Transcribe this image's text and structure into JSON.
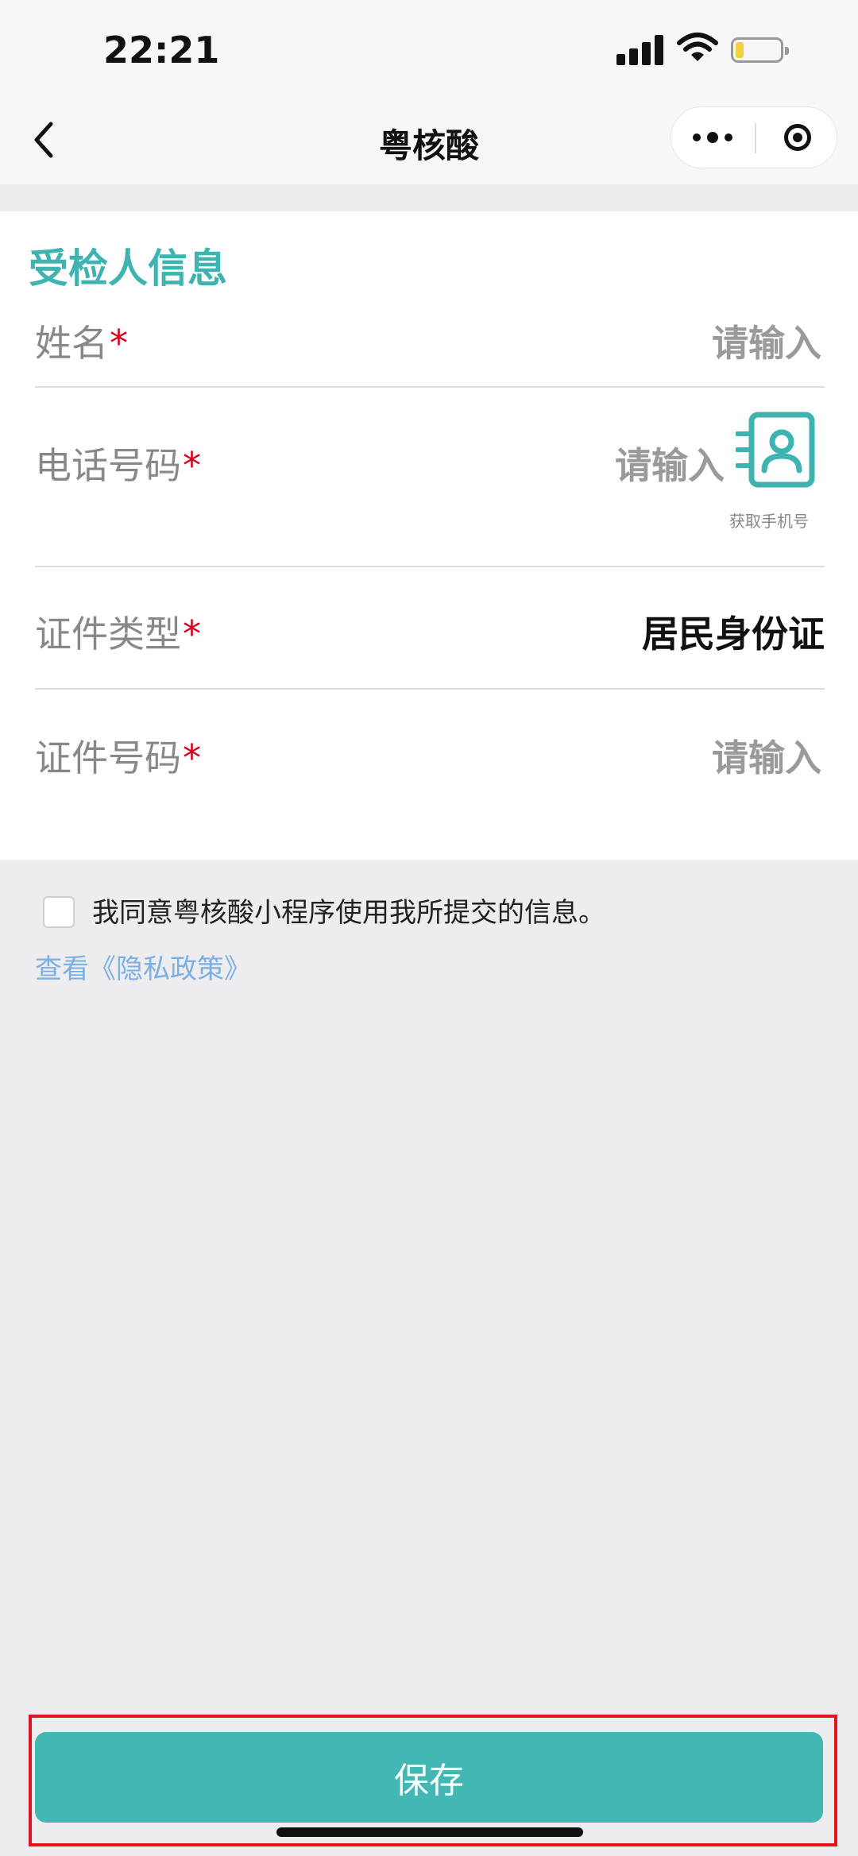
{
  "status_bar": {
    "time": "22:21"
  },
  "nav": {
    "title": "粤核酸"
  },
  "form": {
    "section_title": "受检人信息",
    "required_mark": "*",
    "fields": [
      {
        "label": "姓名",
        "placeholder": "请输入"
      },
      {
        "label": "电话号码",
        "placeholder": "请输入",
        "action_caption": "获取手机号"
      },
      {
        "label": "证件类型",
        "value": "居民身份证"
      },
      {
        "label": "证件号码",
        "placeholder": "请输入"
      }
    ]
  },
  "agreement": {
    "checked": false,
    "text": "我同意粤核酸小程序使用我所提交的信息。",
    "privacy_link": "查看《隐私政策》"
  },
  "footer": {
    "save_label": "保存"
  },
  "colors": {
    "accent": "#43b7b3",
    "required": "#d0021b",
    "link": "#7bb0e0",
    "highlight": "#e4141c"
  },
  "icons": {
    "back": "chevron-left-icon",
    "more": "more-dots-icon",
    "close": "target-close-icon",
    "contact": "contact-card-icon",
    "wifi": "wifi-icon",
    "signal": "signal-icon",
    "battery": "battery-icon"
  }
}
